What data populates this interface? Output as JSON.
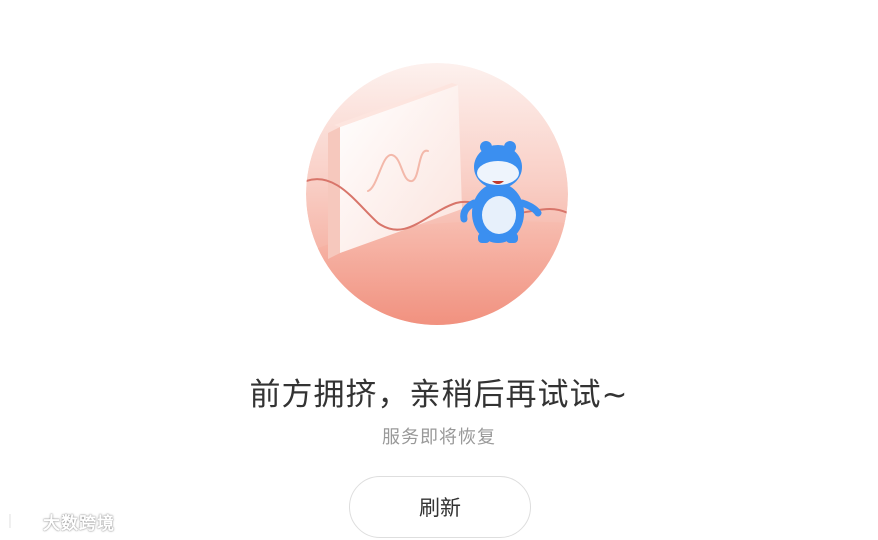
{
  "error": {
    "title": "前方拥挤，亲稍后再试试~",
    "subtitle": "服务即将恢复"
  },
  "actions": {
    "refresh_label": "刷新"
  },
  "watermark": {
    "text": "大数跨境"
  },
  "colors": {
    "circle_top": "#fde9e4",
    "circle_bottom": "#f39b8b",
    "mascot_blue": "#3b8ff0",
    "title_text": "#333333",
    "subtitle_text": "#999999",
    "button_border": "#dedede"
  }
}
